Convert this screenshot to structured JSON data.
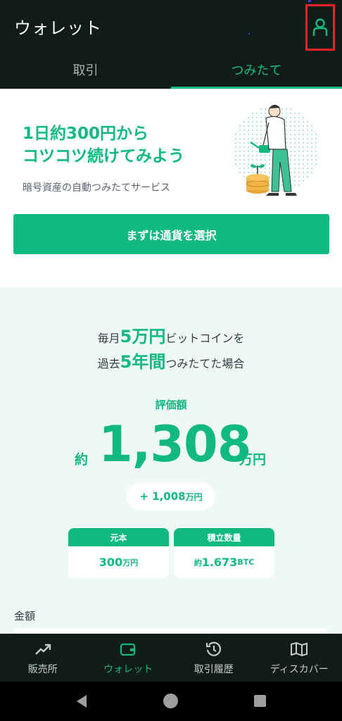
{
  "header": {
    "title": "ウォレット",
    "profile_icon": "person-icon"
  },
  "tabs": [
    {
      "label": "取引",
      "active": false
    },
    {
      "label": "つみたて",
      "active": true
    }
  ],
  "promo": {
    "heading_line1": "1日約300円から",
    "heading_line2": "コツコツ続けてみよう",
    "subtitle": "暗号資産の自動つみたてサービス",
    "cta_label": "まずは通貨を選択"
  },
  "simulation": {
    "line1_prefix": "毎月",
    "line1_highlight": "5万円",
    "line1_suffix": "ビットコインを",
    "line2_prefix": "過去",
    "line2_highlight": "5年間",
    "line2_suffix": "つみたてた場合",
    "eval_label": "評価額",
    "approx": "約",
    "value": "1,308",
    "unit": "万円",
    "gain_value": "+ 1,008",
    "gain_unit": "万円",
    "principal_label": "元本",
    "principal_value": "300",
    "principal_unit": "万円",
    "quantity_label": "積立数量",
    "quantity_prefix": "約",
    "quantity_value": "1.673",
    "quantity_unit": "BTC",
    "amount_label": "金額"
  },
  "bottom_nav": [
    {
      "label": "販売所",
      "icon": "trend-chart-icon",
      "active": false
    },
    {
      "label": "ウォレット",
      "icon": "wallet-icon",
      "active": true
    },
    {
      "label": "取引履歴",
      "icon": "history-icon",
      "active": false
    },
    {
      "label": "ディスカバー",
      "icon": "map-icon",
      "active": false
    }
  ],
  "system_nav": {
    "back_icon": "back-triangle-icon",
    "home_icon": "home-circle-icon",
    "recent_icon": "recent-square-icon"
  },
  "colors": {
    "accent": "#10b981",
    "header_bg": "#0f1c18",
    "sim_bg": "#eef8f4",
    "highlight_box": "#e8242a"
  }
}
